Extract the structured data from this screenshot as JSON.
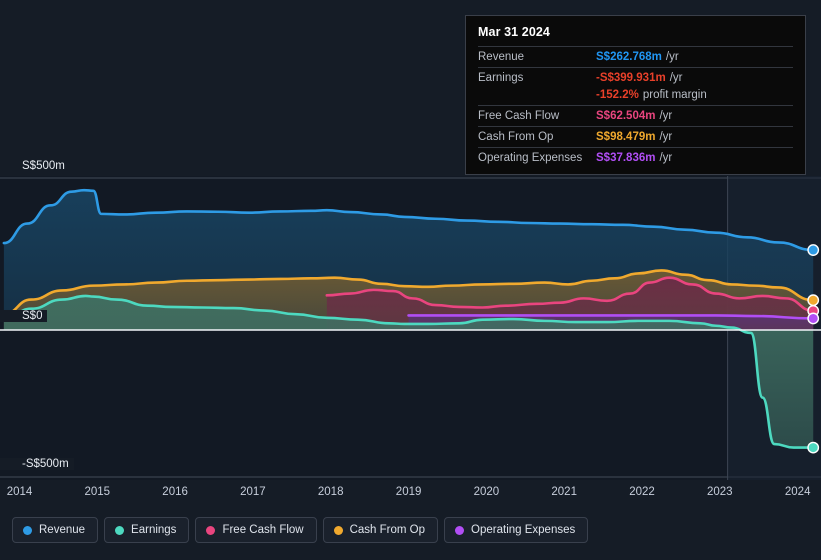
{
  "axes": {
    "y_ticks": [
      {
        "label": "S$500m",
        "value": 500
      },
      {
        "label": "S$0",
        "value": 0
      },
      {
        "label": "-S$500m",
        "value": -500
      }
    ],
    "x_ticks": [
      "2014",
      "2015",
      "2016",
      "2017",
      "2018",
      "2019",
      "2020",
      "2021",
      "2022",
      "2023",
      "2024"
    ]
  },
  "tooltip": {
    "date": "Mar 31 2024",
    "rows": [
      {
        "name": "Revenue",
        "value": "S$262.768m",
        "unit": "/yr",
        "color": "#2196f3"
      },
      {
        "name": "Earnings",
        "value": "-S$399.931m",
        "unit": "/yr",
        "color": "#e8402a"
      },
      {
        "name": "",
        "value": "-152.2%",
        "unit": "profit margin",
        "color": "#e8402a",
        "sub": true
      },
      {
        "name": "Free Cash Flow",
        "value": "S$62.504m",
        "unit": "/yr",
        "color": "#e9457f"
      },
      {
        "name": "Cash From Op",
        "value": "S$98.479m",
        "unit": "/yr",
        "color": "#f0a92e"
      },
      {
        "name": "Operating Expenses",
        "value": "S$37.836m",
        "unit": "/yr",
        "color": "#b14ef5"
      }
    ]
  },
  "legend": [
    {
      "label": "Revenue",
      "color": "#2e9be5"
    },
    {
      "label": "Earnings",
      "color": "#4dd9c0"
    },
    {
      "label": "Free Cash Flow",
      "color": "#e9457f"
    },
    {
      "label": "Cash From Op",
      "color": "#f0a92e"
    },
    {
      "label": "Operating Expenses",
      "color": "#b14ef5"
    }
  ],
  "chart_data": {
    "type": "area",
    "title": "",
    "xlabel": "",
    "ylabel": "",
    "currency": "S$",
    "units": "millions",
    "ylim": [
      -560,
      560
    ],
    "xlim": [
      2013.8,
      2024.35
    ],
    "grid": true,
    "legend_position": "bottom",
    "zero_line": 0,
    "forecast_divider_x": 2023.15,
    "annotation_date": "Mar 31 2024",
    "series": [
      {
        "name": "Revenue",
        "color": "#2e9be5",
        "fill": "#18415e",
        "x": [
          2013.85,
          2014.15,
          2014.45,
          2014.72,
          2014.88,
          2015.0,
          2015.1,
          2015.4,
          2015.8,
          2016.2,
          2016.6,
          2017.0,
          2017.4,
          2017.8,
          2018.0,
          2018.3,
          2018.7,
          2019.0,
          2019.4,
          2019.8,
          2020.2,
          2020.6,
          2021.0,
          2021.4,
          2021.8,
          2022.2,
          2022.6,
          2023.0,
          2023.4,
          2023.8,
          2024.25
        ],
        "y": [
          286,
          350,
          410,
          455,
          460,
          458,
          382,
          380,
          386,
          390,
          389,
          386,
          390,
          392,
          394,
          388,
          380,
          372,
          366,
          360,
          356,
          352,
          350,
          348,
          346,
          340,
          330,
          320,
          305,
          288,
          263
        ]
      },
      {
        "name": "Earnings",
        "color": "#4dd9c0",
        "fill": "#3f6f62",
        "x": [
          2013.85,
          2014.2,
          2014.6,
          2014.9,
          2015.0,
          2015.3,
          2015.7,
          2016.0,
          2016.4,
          2016.8,
          2017.2,
          2017.6,
          2018.0,
          2018.4,
          2018.8,
          2019.0,
          2019.3,
          2019.7,
          2020.0,
          2020.4,
          2020.8,
          2021.2,
          2021.6,
          2022.0,
          2022.4,
          2022.8,
          2023.0,
          2023.2,
          2023.45,
          2023.6,
          2023.75,
          2024.0,
          2024.25
        ],
        "y": [
          34,
          70,
          100,
          112,
          110,
          100,
          80,
          76,
          74,
          72,
          64,
          52,
          40,
          34,
          22,
          20,
          20,
          22,
          34,
          36,
          30,
          26,
          26,
          30,
          30,
          22,
          14,
          8,
          -10,
          -230,
          -388,
          -400,
          -400
        ]
      },
      {
        "name": "Free Cash Flow",
        "color": "#e9457f",
        "fill": "#6b2b47",
        "x": [
          2018.0,
          2018.3,
          2018.6,
          2018.85,
          2019.1,
          2019.4,
          2019.7,
          2020.0,
          2020.3,
          2020.7,
          2021.0,
          2021.3,
          2021.6,
          2021.9,
          2022.15,
          2022.4,
          2022.7,
          2023.0,
          2023.3,
          2023.6,
          2023.9,
          2024.25
        ],
        "y": [
          114,
          120,
          132,
          128,
          104,
          82,
          76,
          74,
          80,
          86,
          90,
          104,
          96,
          120,
          156,
          172,
          150,
          120,
          104,
          112,
          104,
          63
        ]
      },
      {
        "name": "Cash From Op",
        "color": "#f0a92e",
        "fill": "#6d5a33",
        "x": [
          2013.85,
          2014.2,
          2014.6,
          2015.0,
          2015.4,
          2015.8,
          2016.2,
          2016.6,
          2017.0,
          2017.4,
          2017.8,
          2018.1,
          2018.4,
          2018.7,
          2019.0,
          2019.3,
          2019.6,
          2020.0,
          2020.4,
          2020.8,
          2021.1,
          2021.4,
          2021.7,
          2022.0,
          2022.3,
          2022.6,
          2022.9,
          2023.2,
          2023.5,
          2023.8,
          2024.25
        ],
        "y": [
          52,
          100,
          130,
          146,
          150,
          156,
          162,
          164,
          166,
          168,
          170,
          172,
          166,
          152,
          144,
          142,
          146,
          150,
          152,
          156,
          150,
          162,
          170,
          186,
          196,
          182,
          164,
          150,
          146,
          140,
          98
        ]
      },
      {
        "name": "Operating Expenses",
        "color": "#b14ef5",
        "fill": "#5a3370",
        "x": [
          2019.05,
          2019.5,
          2020.0,
          2020.5,
          2021.0,
          2021.5,
          2022.0,
          2022.5,
          2023.0,
          2023.5,
          2024.25
        ],
        "y": [
          48,
          48,
          48,
          48,
          48,
          48,
          48,
          48,
          48,
          46,
          38
        ]
      }
    ]
  }
}
